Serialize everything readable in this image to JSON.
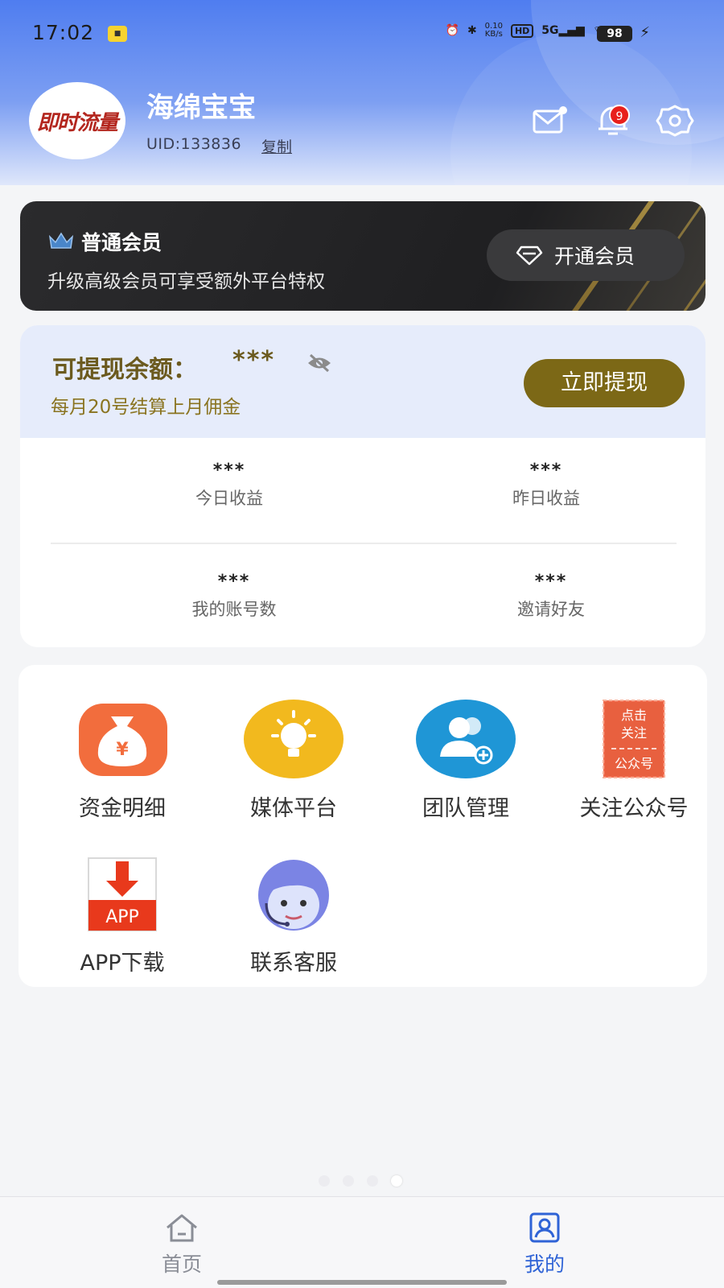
{
  "status_bar": {
    "time": "17:02",
    "net_speed_value": "0.10",
    "net_speed_unit": "KB/s",
    "hd": "HD",
    "signal": "5G",
    "battery": "98"
  },
  "header": {
    "avatar_text": "即时流量",
    "user_name": "海绵宝宝",
    "uid": "UID:133836",
    "copy_label": "复制",
    "notification_count": "9"
  },
  "membership": {
    "title": "普通会员",
    "description": "升级高级会员可享受额外平台特权",
    "button_label": "开通会员"
  },
  "balance": {
    "label": "可提现余额：",
    "value": "***",
    "note": "每月20号结算上月佣金",
    "withdraw_label": "立即提现",
    "stats": [
      {
        "value": "***",
        "label": "今日收益"
      },
      {
        "value": "***",
        "label": "昨日收益"
      },
      {
        "value": "***",
        "label": "我的账号数"
      },
      {
        "value": "***",
        "label": "邀请好友"
      }
    ]
  },
  "grid": [
    {
      "label": "资金明细",
      "icon": "money-bag-icon"
    },
    {
      "label": "媒体平台",
      "icon": "lightbulb-icon"
    },
    {
      "label": "团队管理",
      "icon": "team-icon"
    },
    {
      "label": "关注公众号",
      "icon": "follow-stamp-icon",
      "stamp_lines": [
        "点击",
        "关注",
        "公众号"
      ]
    },
    {
      "label": "APP下载",
      "icon": "app-download-icon",
      "badge_text": "APP"
    },
    {
      "label": "联系客服",
      "icon": "customer-service-icon"
    }
  ],
  "bottom_nav": {
    "home_label": "首页",
    "mine_label": "我的",
    "active": "mine"
  },
  "colors": {
    "header_blue": "#4f7df0",
    "gold_text": "#6b5a1e",
    "withdraw_button": "#7c6816",
    "active_nav": "#2f63d6"
  }
}
